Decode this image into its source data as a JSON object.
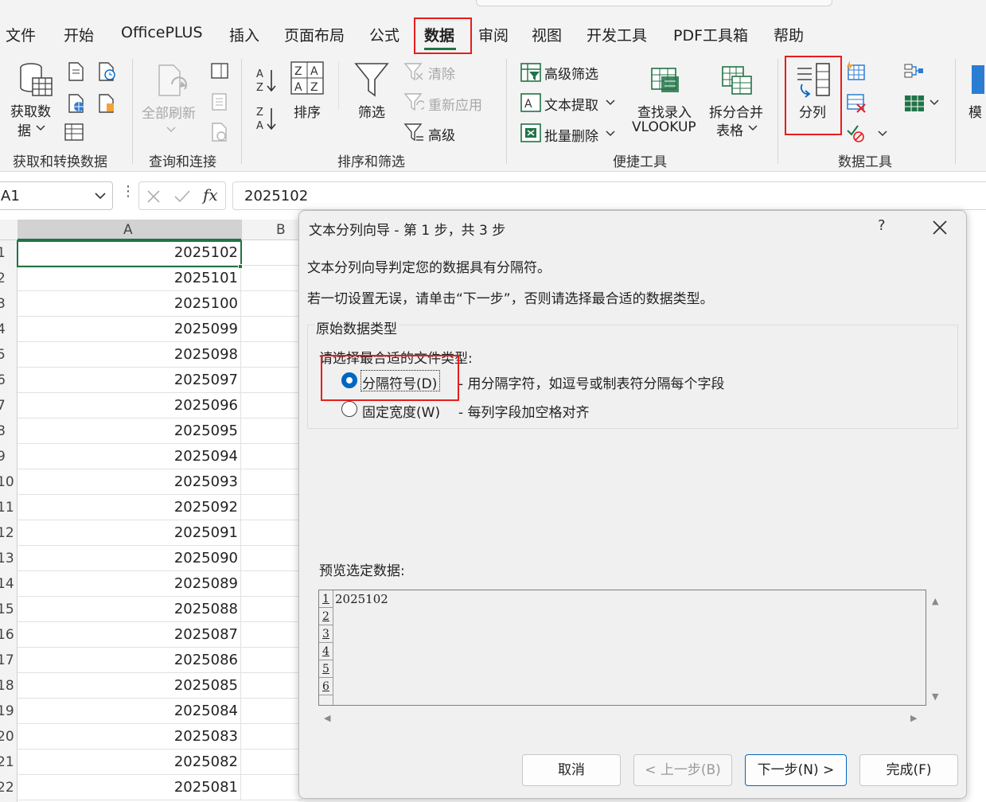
{
  "tabs": [
    {
      "label": "文件",
      "active": false
    },
    {
      "label": "开始",
      "active": false
    },
    {
      "label": "OfficePLUS",
      "active": false
    },
    {
      "label": "插入",
      "active": false
    },
    {
      "label": "页面布局",
      "active": false
    },
    {
      "label": "公式",
      "active": false
    },
    {
      "label": "数据",
      "active": true
    },
    {
      "label": "审阅",
      "active": false
    },
    {
      "label": "视图",
      "active": false
    },
    {
      "label": "开发工具",
      "active": false
    },
    {
      "label": "PDF工具箱",
      "active": false
    },
    {
      "label": "帮助",
      "active": false
    }
  ],
  "ribbon": {
    "get_data": {
      "line1": "获取数",
      "line2": "据"
    },
    "refresh_all": "全部刷新",
    "sort": "排序",
    "filter": "筛选",
    "clear": "清除",
    "reapply": "重新应用",
    "advanced": "高级",
    "adv_filter": "高级筛选",
    "text_extract": "文本提取",
    "batch_delete": "批量删除",
    "lookup": {
      "line1": "查找录入",
      "line2": "VLOOKUP"
    },
    "split_merge": {
      "line1": "拆分合并",
      "line2": "表格"
    },
    "text_to_columns": "分列",
    "partial_next": "模",
    "groups": [
      "获取和转换数据",
      "查询和连接",
      "排序和筛选",
      "便捷工具",
      "数据工具"
    ]
  },
  "formula_bar": {
    "name_box": "A1",
    "dots": "⋮",
    "fx": "fx",
    "formula": "2025102"
  },
  "grid": {
    "columns": [
      "A",
      "B"
    ],
    "rows": [
      {
        "num": "1",
        "value": "2025102"
      },
      {
        "num": "2",
        "value": "2025101"
      },
      {
        "num": "3",
        "value": "2025100"
      },
      {
        "num": "4",
        "value": "2025099"
      },
      {
        "num": "5",
        "value": "2025098"
      },
      {
        "num": "6",
        "value": "2025097"
      },
      {
        "num": "7",
        "value": "2025096"
      },
      {
        "num": "8",
        "value": "2025095"
      },
      {
        "num": "9",
        "value": "2025094"
      },
      {
        "num": "10",
        "value": "2025093"
      },
      {
        "num": "11",
        "value": "2025092"
      },
      {
        "num": "12",
        "value": "2025091"
      },
      {
        "num": "13",
        "value": "2025090"
      },
      {
        "num": "14",
        "value": "2025089"
      },
      {
        "num": "15",
        "value": "2025088"
      },
      {
        "num": "16",
        "value": "2025087"
      },
      {
        "num": "17",
        "value": "2025086"
      },
      {
        "num": "18",
        "value": "2025085"
      },
      {
        "num": "19",
        "value": "2025084"
      },
      {
        "num": "20",
        "value": "2025083"
      },
      {
        "num": "21",
        "value": "2025082"
      },
      {
        "num": "22",
        "value": "2025081"
      }
    ]
  },
  "dialog": {
    "title": "文本分列向导 - 第 1 步，共 3 步",
    "help": "?",
    "intro1": "文本分列向导判定您的数据具有分隔符。",
    "intro2": "若一切设置无误，请单击“下一步”，否则请选择最合适的数据类型。",
    "group_title": "原始数据类型",
    "choose_label": "请选择最合适的文件类型:",
    "option_delimited": {
      "label": "分隔符号(D)",
      "desc": "- 用分隔字符，如逗号或制表符分隔每个字段",
      "selected": true
    },
    "option_fixed": {
      "label": "固定宽度(W)",
      "desc": "- 每列字段加空格对齐",
      "selected": false
    },
    "preview_label": "预览选定数据:",
    "preview_lines": [
      "2025102",
      "",
      "",
      "",
      "",
      ""
    ],
    "preview_line_numbers": [
      "1",
      "2",
      "3",
      "4",
      "5",
      "6"
    ],
    "buttons": {
      "cancel": "取消",
      "back": "< 上一步(B)",
      "next": "下一步(N) >",
      "finish": "完成(F)"
    }
  },
  "colors": {
    "accent_green": "#217346",
    "highlight_red": "#e81c1c",
    "radio_blue": "#0067c0"
  }
}
